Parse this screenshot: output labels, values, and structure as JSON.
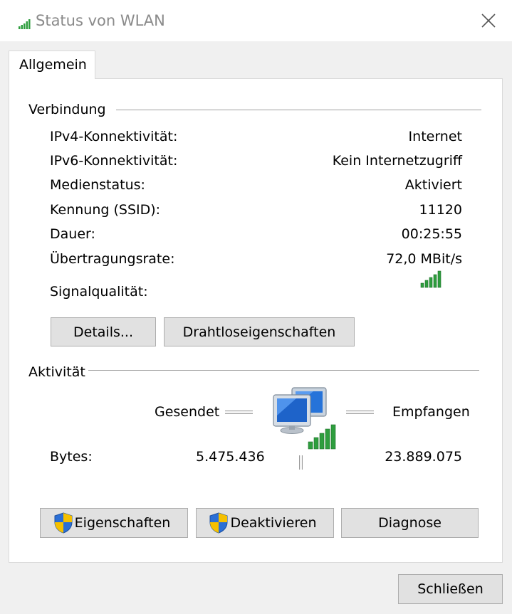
{
  "window": {
    "title": "Status von WLAN",
    "close_icon": "close-icon",
    "title_icon": "signal-bars-icon"
  },
  "tabs": [
    {
      "label": "Allgemein",
      "selected": true
    }
  ],
  "connection": {
    "group_label": "Verbindung",
    "rows": [
      {
        "label": "IPv4-Konnektivität:",
        "value": "Internet"
      },
      {
        "label": "IPv6-Konnektivität:",
        "value": "Kein Internetzugriff"
      },
      {
        "label": "Medienstatus:",
        "value": "Aktiviert"
      },
      {
        "label": "Kennung (SSID):",
        "value": "11120"
      },
      {
        "label": "Dauer:",
        "value": "00:25:55"
      },
      {
        "label": "Übertragungsrate:",
        "value": "72,0 MBit/s"
      }
    ],
    "signal_label": "Signalqualität:",
    "signal_bars_filled": 5,
    "signal_bars_total": 5,
    "buttons": {
      "details": "Details...",
      "wireless_properties": "Drahtloseigenschaften"
    }
  },
  "activity": {
    "group_label": "Aktivität",
    "sent_label": "Gesendet",
    "received_label": "Empfangen",
    "bytes_label": "Bytes:",
    "bytes_sent": "5.475.436",
    "bytes_received": "23.889.075"
  },
  "bottom_buttons": {
    "properties": "Eigenschaften",
    "disable": "Deaktivieren",
    "diagnose": "Diagnose"
  },
  "footer": {
    "close": "Schließen"
  },
  "colors": {
    "signal_green": "#2e9e3e",
    "shield_blue": "#2b6fd6",
    "shield_yellow": "#f5c000",
    "button_face": "#e1e1e1",
    "button_border": "#adadad"
  }
}
